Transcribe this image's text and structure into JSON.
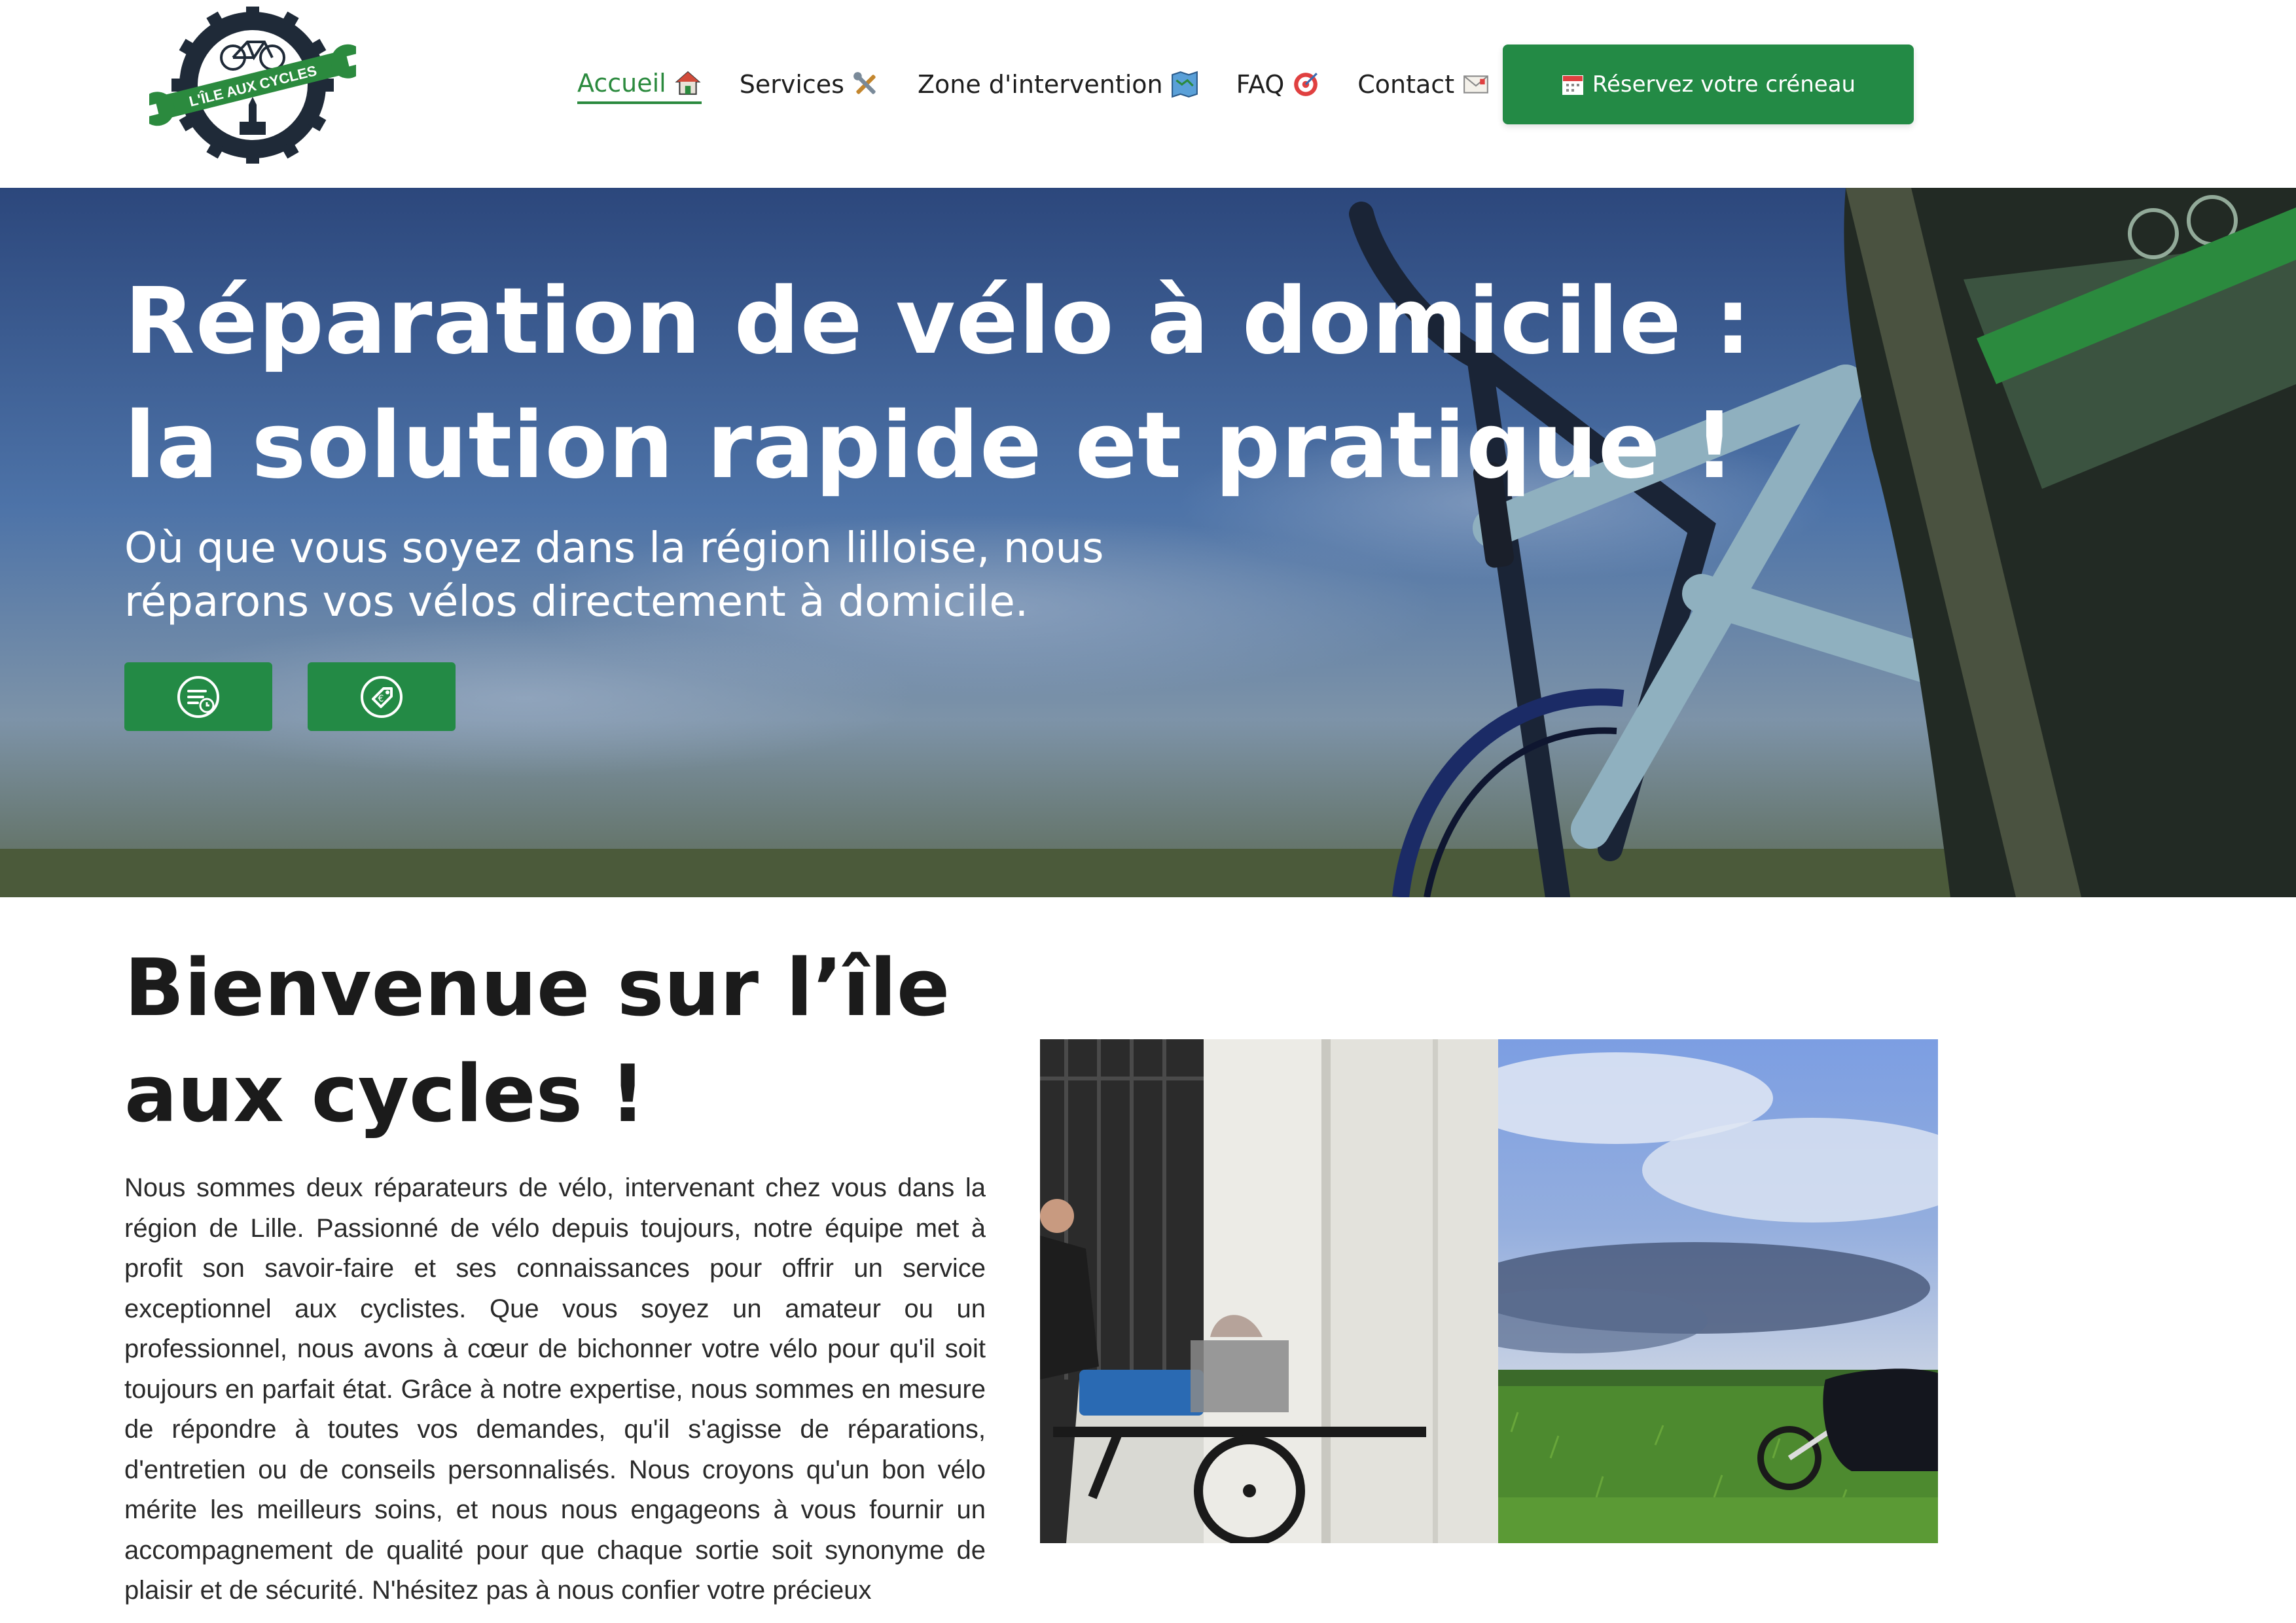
{
  "brand": {
    "name": "L'ÎLE AUX CYCLES",
    "colors": {
      "accent": "#238a45",
      "active_nav": "#2b8a3e",
      "text": "#1b1b1b"
    }
  },
  "nav": {
    "items": [
      {
        "label": "Accueil",
        "icon": "house-icon",
        "active": true
      },
      {
        "label": "Services",
        "icon": "tools-icon",
        "active": false
      },
      {
        "label": "Zone d'intervention",
        "icon": "map-icon",
        "active": false
      },
      {
        "label": "FAQ",
        "icon": "target-icon",
        "active": false
      },
      {
        "label": "Contact",
        "icon": "envelope-icon",
        "active": false
      }
    ],
    "cta_label": "Réservez votre créneau",
    "cta_icon": "calendar-icon"
  },
  "hero": {
    "title": "Réparation de vélo à domicile : la solution rapide et pratique !",
    "subtitle": "Où que vous soyez dans la région lilloise, nous réparons vos vélos directement à domicile.",
    "buttons": [
      {
        "icon": "quote-document-icon"
      },
      {
        "icon": "price-tag-icon"
      }
    ]
  },
  "welcome": {
    "title": "Bienvenue sur l’île aux cycles !",
    "text": "Nous sommes deux réparateurs de vélo, intervenant chez vous dans la région de Lille. Passionné de vélo depuis toujours, notre équipe met à profit son savoir-faire et ses connaissances pour offrir un service exceptionnel aux cyclistes. Que vous soyez un amateur ou un professionnel, nous avons à cœur de bichonner votre vélo pour qu'il soit toujours en parfait état. Grâce à notre expertise, nous sommes en mesure de répondre à toutes vos demandes, qu'il s'agisse de réparations, d'entretien ou de conseils personnalisés. Nous croyons qu'un bon vélo mérite les meilleurs soins, et nous nous engageons à vous fournir un accompagnement de qualité pour que chaque sortie soit synonyme de plaisir et de sécurité. N'hésitez pas à nous confier votre précieux"
  }
}
